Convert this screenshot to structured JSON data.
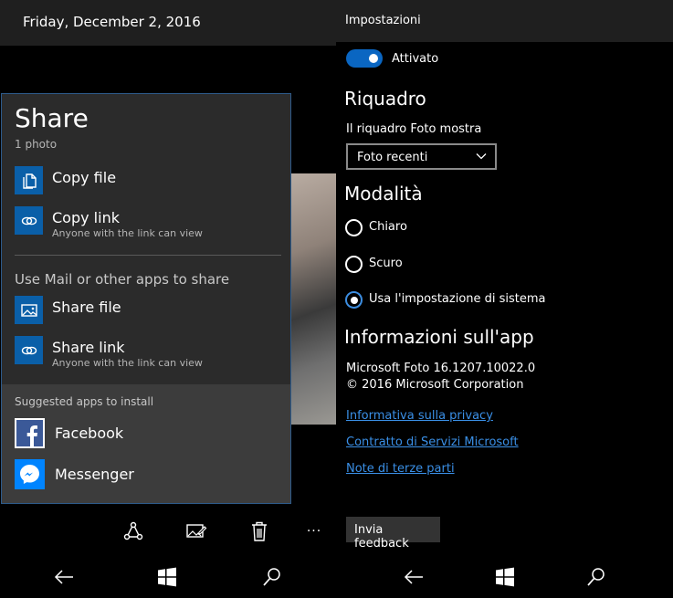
{
  "left": {
    "date": "Friday, December 2, 2016",
    "share": {
      "title": "Share",
      "subtitle": "1 photo",
      "items": [
        {
          "label": "Copy file",
          "sub": ""
        },
        {
          "label": "Copy link",
          "sub": "Anyone with the link can view"
        }
      ],
      "section": "Use Mail or other apps to share",
      "items2": [
        {
          "label": "Share file",
          "sub": ""
        },
        {
          "label": "Share link",
          "sub": "Anyone with the link can view"
        }
      ],
      "suggested_header": "Suggested apps to install",
      "apps": [
        {
          "label": "Facebook",
          "icon": "facebook-icon",
          "color": "#3b5998"
        },
        {
          "label": "Messenger",
          "icon": "messenger-icon",
          "color": "#0084ff"
        }
      ]
    },
    "appbar": {
      "icons": [
        "share-icon",
        "edit-image-icon",
        "delete-icon",
        "more-icon"
      ],
      "more_label": "···"
    }
  },
  "right": {
    "title": "Impostazioni",
    "toggle_label": "Attivato",
    "section_tile": "Riquadro",
    "tile_label": "Il riquadro Foto mostra",
    "tile_select": "Foto recenti",
    "section_mode": "Modalità",
    "modes": [
      "Chiaro",
      "Scuro",
      "Usa l'impostazione di sistema"
    ],
    "selected_mode": 2,
    "section_info": "Informazioni sull'app",
    "app_version": "Microsoft Foto 16.1207.10022.0",
    "copyright": "© 2016 Microsoft Corporation",
    "links": [
      "Informativa sulla privacy",
      "Contratto di Servizi Microsoft",
      "Note di terze parti"
    ],
    "feedback_button": "Invia feedback"
  },
  "colors": {
    "accent": "#0a66c2",
    "link": "#3a8fe6",
    "tile_blue": "#0a5fa8"
  }
}
